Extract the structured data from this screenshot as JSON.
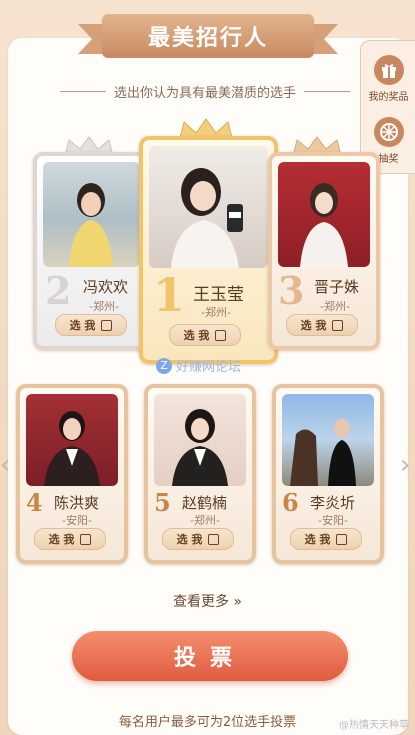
{
  "header": {
    "title": "最美招行人",
    "subtitle": "选出你认为具有最美潜质的选手"
  },
  "side_panel": {
    "prizes_label": "我的奖品",
    "lottery_label": "抽奖"
  },
  "candidates": [
    {
      "rank": "2",
      "name": "冯欢欢",
      "city": "-郑州-",
      "vote_label": "选 我"
    },
    {
      "rank": "1",
      "name": "王玉莹",
      "city": "-郑州-",
      "vote_label": "选 我"
    },
    {
      "rank": "3",
      "name": "晋子姝",
      "city": "-郑州-",
      "vote_label": "选 我"
    },
    {
      "rank": "4",
      "name": "陈洪爽",
      "city": "-安阳-",
      "vote_label": "选 我"
    },
    {
      "rank": "5",
      "name": "赵鹤楠",
      "city": "-郑州-",
      "vote_label": "选 我"
    },
    {
      "rank": "6",
      "name": "李炎圻",
      "city": "-安阳-",
      "vote_label": "选 我"
    }
  ],
  "watermark": "好赚网论坛",
  "see_more": "查看更多 »",
  "vote_button": "投票",
  "footer_note": "每名用户最多可为2位选手投票",
  "weibo_mark": "@热情天天种草",
  "colors": {
    "accent": "#df5b3f",
    "gold": "#f0c56a",
    "ribbon": "#c78a61"
  }
}
